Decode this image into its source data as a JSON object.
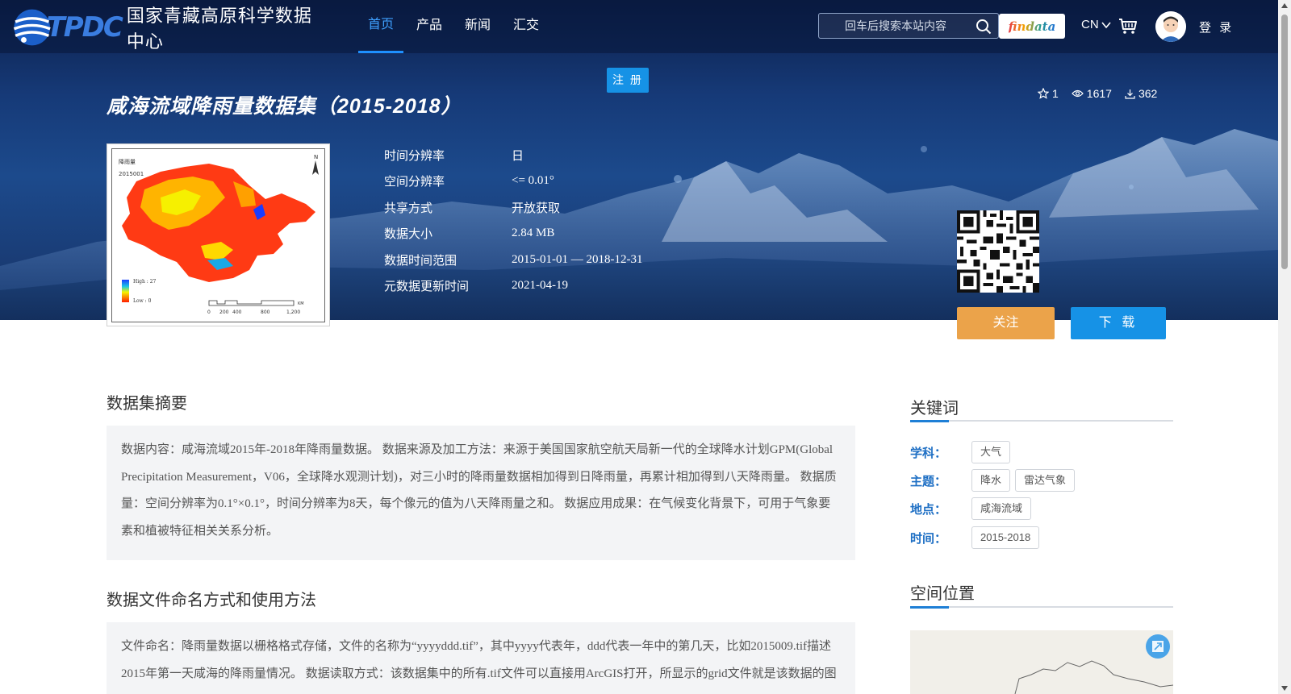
{
  "header": {
    "logo_letters": "TPDC",
    "logo_text": "国家青藏高原科学数据中心",
    "nav": [
      {
        "label": "首页",
        "active": true
      },
      {
        "label": "产品",
        "active": false
      },
      {
        "label": "新闻",
        "active": false
      },
      {
        "label": "汇交",
        "active": false
      }
    ],
    "search_placeholder": "回车后搜索本站内容",
    "findata_label": "findata",
    "lang": "CN",
    "login": "登 录",
    "register": "注 册"
  },
  "dataset": {
    "title": "咸海流域降雨量数据集（2015-2018）",
    "stars": "1",
    "views": "1617",
    "downloads": "362",
    "thumbnail": {
      "legend_title": "降雨量",
      "date": "2015001",
      "high": "High : 27",
      "low": "Low : 0",
      "north": "N",
      "scale": [
        "0",
        "200",
        "400",
        "800",
        "1,200"
      ],
      "scale_unit": "KM"
    },
    "meta": [
      {
        "key": "时间分辨率",
        "value": "日"
      },
      {
        "key": "空间分辨率",
        "value": "<= 0.01°"
      },
      {
        "key": "共享方式",
        "value": "开放获取"
      },
      {
        "key": "数据大小",
        "value": "2.84 MB"
      },
      {
        "key": "数据时间范围",
        "value": "2015-01-01 — 2018-12-31"
      },
      {
        "key": "元数据更新时间",
        "value": "2021-04-19"
      }
    ],
    "follow_label": "关注",
    "download_label": "下 载"
  },
  "abstract": {
    "title": "数据集摘要",
    "text": "数据内容：咸海流域2015年-2018年降雨量数据。 数据来源及加工方法：来源于美国国家航空航天局新一代的全球降水计划GPM(Global Precipitation Measurement，V06，全球降水观测计划)，对三小时的降雨量数据相加得到日降雨量，再累计相加得到八天降雨量。 数据质量：空间分辨率为0.1°×0.1°，时间分辨率为8天，每个像元的值为八天降雨量之和。 数据应用成果：在气候变化背景下，可用于气象要素和植被特征相关关系分析。"
  },
  "naming": {
    "title": "数据文件命名方式和使用方法",
    "text": "文件命名：降雨量数据以栅格格式存储，文件的名称为“yyyyddd.tif”，其中yyyy代表年，ddd代表一年中的第几天，比如2015009.tif描述2015年第一天咸海的降雨量情况。 数据读取方式：该数据集中的所有.tif文件可以直接用ArcGIS打开，所显示的grid文件就是该数据的图"
  },
  "sidebar": {
    "keywords_title": "关键词",
    "keywords": [
      {
        "label": "学科：",
        "tags": [
          "大气"
        ]
      },
      {
        "label": "主题：",
        "tags": [
          "降水",
          "雷达气象"
        ]
      },
      {
        "label": "地点：",
        "tags": [
          "咸海流域"
        ]
      },
      {
        "label": "时间：",
        "tags": [
          "2015-2018"
        ]
      }
    ],
    "location_title": "空间位置"
  }
}
